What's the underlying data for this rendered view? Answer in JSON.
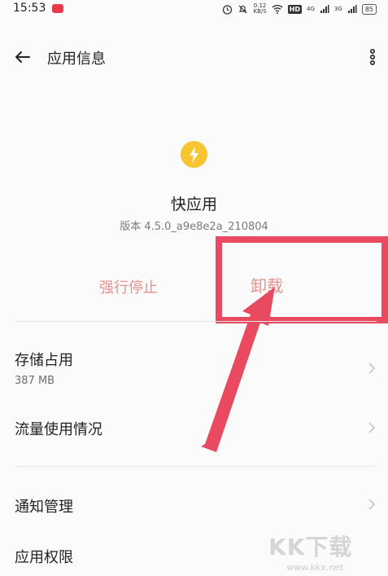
{
  "status_bar": {
    "time": "15:53",
    "app_badge": "app",
    "net_speed_top": "0.12",
    "net_speed_bottom": "KB/S",
    "hd": "HD",
    "net1": "4G",
    "net2": "3G",
    "battery": "85"
  },
  "header": {
    "title": "应用信息"
  },
  "app": {
    "name": "快应用",
    "version": "版本 4.5.0_a9e8e2a_210804",
    "icon_color": "#f6c531"
  },
  "actions": {
    "force_stop": "强行停止",
    "uninstall": "卸载"
  },
  "annotation": {
    "color": "#e94a5f"
  },
  "rows": [
    {
      "label": "存储占用",
      "sub": "387 MB"
    },
    {
      "label": "流量使用情况"
    },
    {
      "label": "通知管理"
    },
    {
      "label": "应用权限"
    }
  ],
  "watermark": {
    "big": "KK下载",
    "small": "www.kkx.net"
  }
}
